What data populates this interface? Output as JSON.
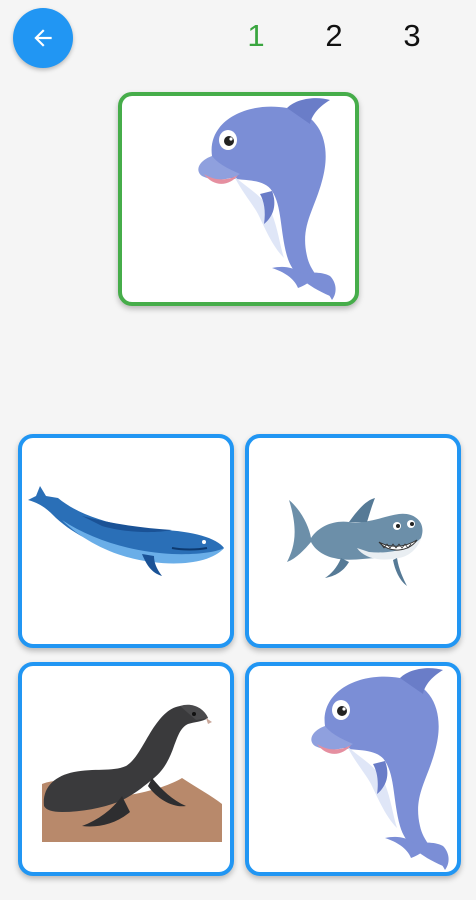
{
  "header": {
    "back_icon": "arrow-left-icon",
    "levels": [
      "1",
      "2",
      "3"
    ],
    "active_level": "1",
    "colors": {
      "back": "#2196f3",
      "active": "#3aa53f",
      "inactive": "#111111"
    }
  },
  "target": {
    "animal": "dolphin",
    "border_color": "#46ad4a"
  },
  "options": [
    {
      "animal": "whale"
    },
    {
      "animal": "shark"
    },
    {
      "animal": "sea-lion"
    },
    {
      "animal": "dolphin"
    }
  ],
  "option_border_color": "#2196f3"
}
